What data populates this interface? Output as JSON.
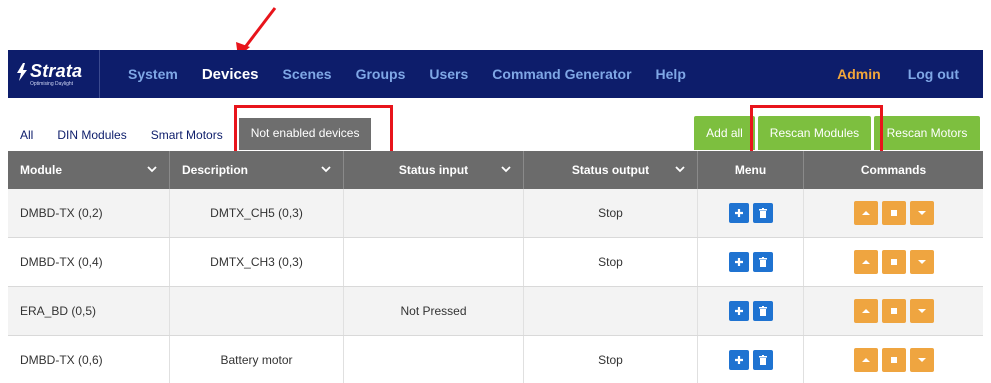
{
  "nav": {
    "logo_text": "Strata",
    "logo_tagline": "Optimising Daylight",
    "items": [
      {
        "label": "System",
        "active": false
      },
      {
        "label": "Devices",
        "active": true
      },
      {
        "label": "Scenes",
        "active": false
      },
      {
        "label": "Groups",
        "active": false
      },
      {
        "label": "Users",
        "active": false
      },
      {
        "label": "Command Generator",
        "active": false
      },
      {
        "label": "Help",
        "active": false
      }
    ],
    "admin_label": "Admin",
    "logout_label": "Log out"
  },
  "subtabs": {
    "all": "All",
    "din_modules": "DIN Modules",
    "smart_motors": "Smart Motors",
    "not_enabled": "Not enabled devices"
  },
  "actions": {
    "add_all": "Add all",
    "rescan_modules": "Rescan Modules",
    "rescan_motors": "Rescan Motors"
  },
  "table": {
    "headers": {
      "module": "Module",
      "description": "Description",
      "status_input": "Status input",
      "status_output": "Status output",
      "menu": "Menu",
      "commands": "Commands"
    },
    "rows": [
      {
        "module": "DMBD-TX (0,2)",
        "description": "DMTX_CH5 (0,3)",
        "status_input": "",
        "status_output": "Stop"
      },
      {
        "module": "DMBD-TX (0,4)",
        "description": "DMTX_CH3 (0,3)",
        "status_input": "",
        "status_output": "Stop"
      },
      {
        "module": "ERA_BD (0,5)",
        "description": "",
        "status_input": "Not Pressed",
        "status_output": ""
      },
      {
        "module": "DMBD-TX (0,6)",
        "description": "Battery motor",
        "status_input": "",
        "status_output": "Stop"
      }
    ]
  },
  "colors": {
    "navbar": "#0d1d6b",
    "nav_link": "#7fa7e6",
    "admin": "#f2a63a",
    "button_green": "#7dbf3f",
    "menu_blue": "#1f73d1",
    "command_orange": "#efa540",
    "highlight_red": "#e8141b"
  },
  "icons": {
    "menu": [
      "plus-icon",
      "trash-icon"
    ],
    "commands": [
      "arrow-up-icon",
      "stop-icon",
      "arrow-down-icon"
    ]
  }
}
